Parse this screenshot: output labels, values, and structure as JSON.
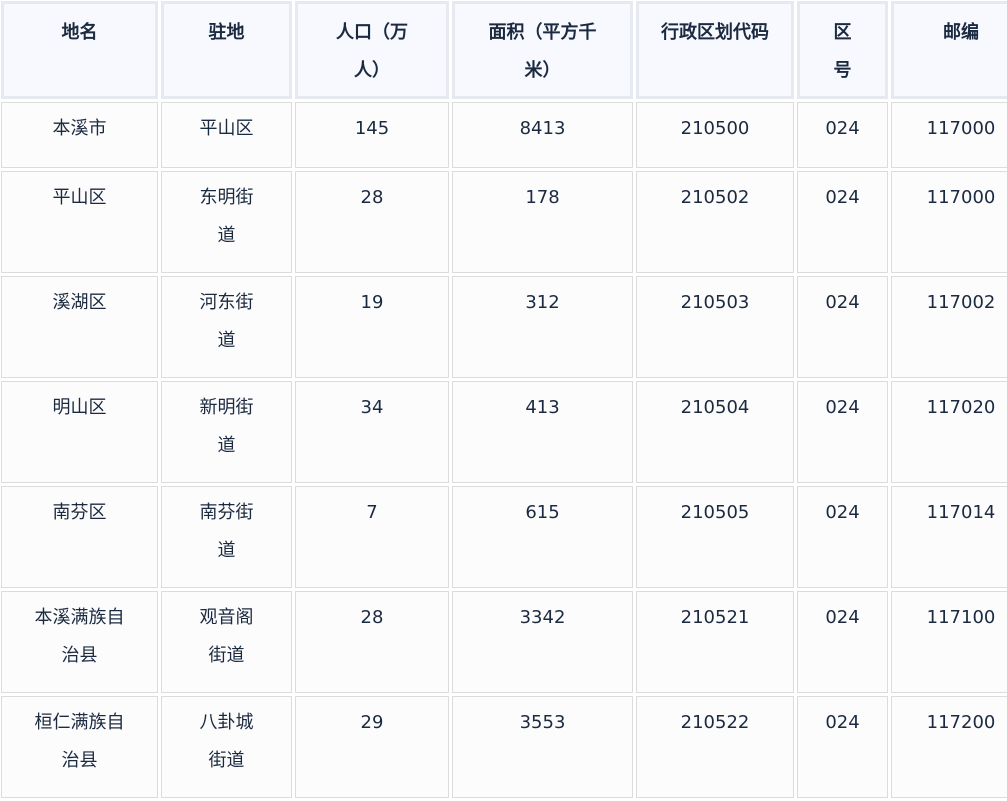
{
  "table": {
    "headers": {
      "name": "地名",
      "seat": "驻地",
      "population": "人口（万人）",
      "area": "面积（平方千米）",
      "admin_code": "行政区划代码",
      "area_code": "区号",
      "postal": "邮编"
    },
    "rows": [
      {
        "name": "本溪市",
        "seat": "平山区",
        "population": "145",
        "area": "8413",
        "admin_code": "210500",
        "area_code": "024",
        "postal": "117000"
      },
      {
        "name": "平山区",
        "seat": "东明街道",
        "population": "28",
        "area": "178",
        "admin_code": "210502",
        "area_code": "024",
        "postal": "117000"
      },
      {
        "name": "溪湖区",
        "seat": "河东街道",
        "population": "19",
        "area": "312",
        "admin_code": "210503",
        "area_code": "024",
        "postal": "117002"
      },
      {
        "name": "明山区",
        "seat": "新明街道",
        "population": "34",
        "area": "413",
        "admin_code": "210504",
        "area_code": "024",
        "postal": "117020"
      },
      {
        "name": "南芬区",
        "seat": "南芬街道",
        "population": "7",
        "area": "615",
        "admin_code": "210505",
        "area_code": "024",
        "postal": "117014"
      },
      {
        "name": "本溪满族自治县",
        "seat": "观音阁街道",
        "population": "28",
        "area": "3342",
        "admin_code": "210521",
        "area_code": "024",
        "postal": "117100"
      },
      {
        "name": "桓仁满族自治县",
        "seat": "八卦城街道",
        "population": "29",
        "area": "3553",
        "admin_code": "210522",
        "area_code": "024",
        "postal": "117200"
      }
    ]
  }
}
